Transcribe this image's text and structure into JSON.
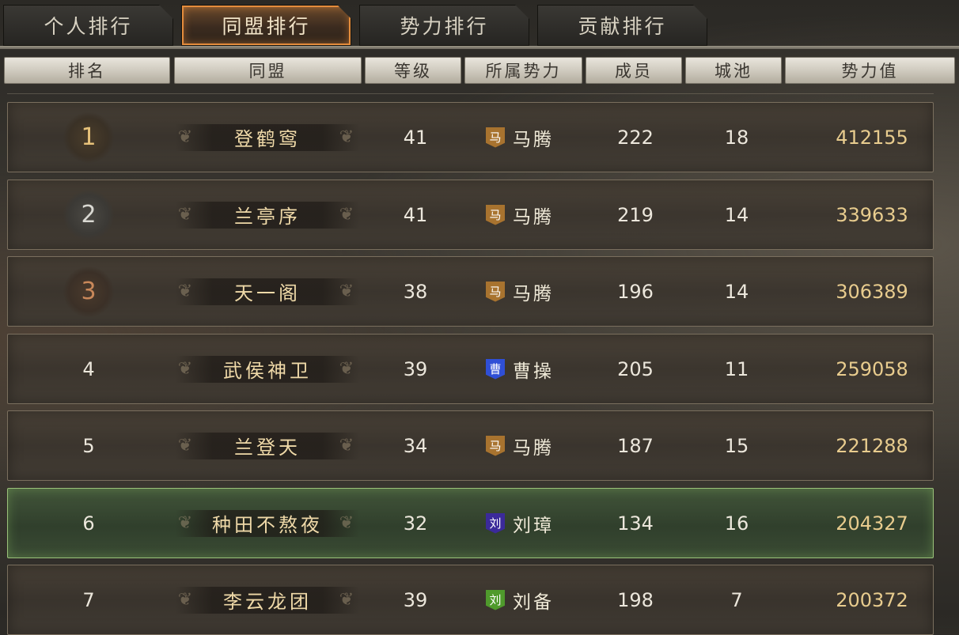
{
  "tabs": [
    {
      "label": "个人排行",
      "active": false
    },
    {
      "label": "同盟排行",
      "active": true
    },
    {
      "label": "势力排行",
      "active": false
    },
    {
      "label": "贡献排行",
      "active": false
    }
  ],
  "columns": [
    "排名",
    "同盟",
    "等级",
    "所属势力",
    "成员",
    "城池",
    "势力值"
  ],
  "rows": [
    {
      "rank": "1",
      "alliance": "登鹤窎",
      "level": "41",
      "faction_badge": "马",
      "faction": "马腾",
      "members": "222",
      "cities": "18",
      "power": "412155"
    },
    {
      "rank": "2",
      "alliance": "兰亭序",
      "level": "41",
      "faction_badge": "马",
      "faction": "马腾",
      "members": "219",
      "cities": "14",
      "power": "339633"
    },
    {
      "rank": "3",
      "alliance": "天一阁",
      "level": "38",
      "faction_badge": "马",
      "faction": "马腾",
      "members": "196",
      "cities": "14",
      "power": "306389"
    },
    {
      "rank": "4",
      "alliance": "武侯神卫",
      "level": "39",
      "faction_badge": "曹",
      "faction": "曹操",
      "members": "205",
      "cities": "11",
      "power": "259058"
    },
    {
      "rank": "5",
      "alliance": "兰登天",
      "level": "34",
      "faction_badge": "马",
      "faction": "马腾",
      "members": "187",
      "cities": "15",
      "power": "221288"
    },
    {
      "rank": "6",
      "alliance": "种田不熬夜",
      "level": "32",
      "faction_badge": "刘",
      "faction": "刘璋",
      "members": "134",
      "cities": "16",
      "power": "204327"
    },
    {
      "rank": "7",
      "alliance": "李云龙团",
      "level": "39",
      "faction_badge": "刘",
      "faction": "刘备",
      "members": "198",
      "cities": "7",
      "power": "200372"
    }
  ],
  "colors": {
    "badge_ma": "#a8732f",
    "badge_cao": "#2f4fd6",
    "badge_liuzhang": "#3b2a9a",
    "badge_liubei": "#4f9a2c",
    "highlight_row": "#3f5a38",
    "active_tab": "#e48c3c"
  }
}
